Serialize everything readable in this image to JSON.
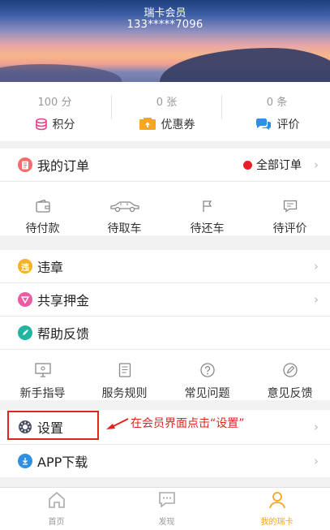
{
  "header": {
    "member_title": "瑞卡会员",
    "phone": "133*****7096"
  },
  "stats": [
    {
      "value": "100 分",
      "label": "积分",
      "icon": "points-icon"
    },
    {
      "value": "0 张",
      "label": "优惠券",
      "icon": "coupon-icon"
    },
    {
      "value": "0 条",
      "label": "评价",
      "icon": "comment-icon"
    }
  ],
  "orders": {
    "title": "我的订单",
    "all_label": "全部订单",
    "statuses": [
      "待付款",
      "待取车",
      "待还车",
      "待评价"
    ]
  },
  "menu": {
    "violation": "违章",
    "deposit": "共享押金",
    "help": "帮助反馈"
  },
  "help_grid": [
    "新手指导",
    "服务规则",
    "常见问题",
    "意见反馈"
  ],
  "settings": "设置",
  "annotation": "在会员界面点击“设置”",
  "app_download": "APP下载",
  "tabbar": [
    {
      "label": "首页",
      "icon": "home-icon",
      "active": false
    },
    {
      "label": "发现",
      "icon": "discover-icon",
      "active": false
    },
    {
      "label": "我的瑞卡",
      "icon": "profile-icon",
      "active": true
    }
  ],
  "colors": {
    "accent": "#f5a623",
    "annotation": "#e0251f",
    "badge_red": "#e8202a"
  }
}
